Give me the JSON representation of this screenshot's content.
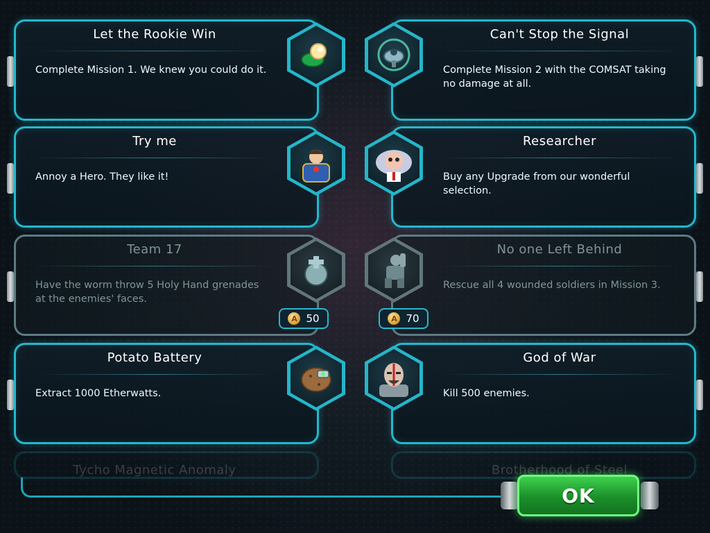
{
  "achievements": [
    {
      "title": "Let the Rookie Win",
      "desc": "Complete Mission 1. We knew you could do it.",
      "icon": "pacifier-icon",
      "state": "unlocked"
    },
    {
      "title": "Can't Stop the Signal",
      "desc": "Complete Mission 2 with the COMSAT taking no damage at all.",
      "icon": "satellite-dish-icon",
      "state": "unlocked"
    },
    {
      "title": "Try me",
      "desc": "Annoy a Hero. They like it!",
      "icon": "hero-portrait-icon",
      "state": "unlocked"
    },
    {
      "title": "Researcher",
      "desc": "Buy any Upgrade from our wonderful selection.",
      "icon": "scientist-portrait-icon",
      "state": "unlocked"
    },
    {
      "title": "Team 17",
      "desc": "Have the worm throw 5 Holy Hand grenades at the enemies' faces.",
      "icon": "holy-grenade-icon",
      "state": "locked",
      "reward": "50"
    },
    {
      "title": "No one Left Behind",
      "desc": "Rescue all 4 wounded soldiers in Mission 3.",
      "icon": "soldier-icon",
      "state": "locked",
      "reward": "70"
    },
    {
      "title": "Potato Battery",
      "desc": "Extract 1000 Etherwatts.",
      "icon": "potato-battery-icon",
      "state": "unlocked"
    },
    {
      "title": "God of War",
      "desc": "Kill 500 enemies.",
      "icon": "warrior-portrait-icon",
      "state": "unlocked"
    },
    {
      "title": "Tycho Magnetic Anomaly",
      "desc": "",
      "icon": "anomaly-icon",
      "state": "faded"
    },
    {
      "title": "Brotherhood of Steel",
      "desc": "",
      "icon": "helmet-icon",
      "state": "faded"
    }
  ],
  "coin_glyph": "A",
  "ok_label": "OK",
  "colors": {
    "accent": "#24b8cc",
    "ok_green": "#2fb63e",
    "locked": "#62767c"
  }
}
